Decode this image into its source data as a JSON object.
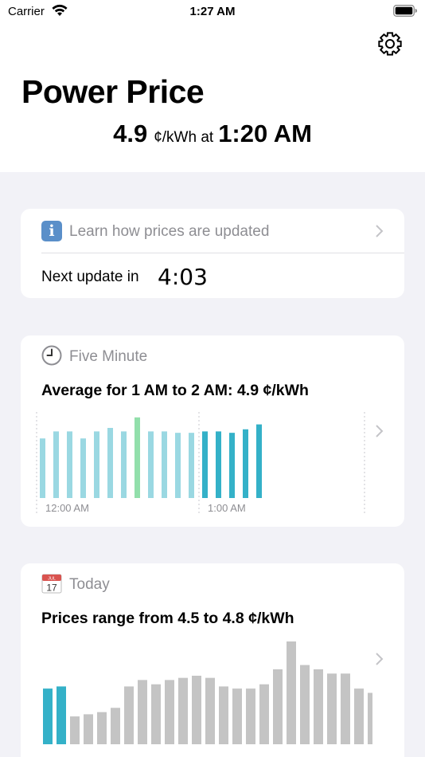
{
  "status_bar": {
    "carrier": "Carrier",
    "time": "1:27 AM"
  },
  "header": {
    "title": "Power Price",
    "current_price": "4.9",
    "unit": "¢/kWh at",
    "current_time": "1:20 AM"
  },
  "update_card": {
    "learn_label": "Learn how prices are updated",
    "next_update_label": "Next update in",
    "next_update_value": "4:03"
  },
  "five_minute_card": {
    "section_label": "Five Minute",
    "headline": "Average for 1 AM to 2 AM: 4.9 ¢/kWh"
  },
  "today_card": {
    "section_label": "Today",
    "calendar_icon_month": "JUL",
    "calendar_icon_day": "17",
    "headline": "Prices range from 4.5 to 4.8 ¢/kWh"
  },
  "colors": {
    "past_bar": "#9ad8e2",
    "current_bar": "#92dfab",
    "hour_bar": "#34b1c8",
    "today_bar": "#c4c4c4",
    "today_highlight": "#34b1c8"
  },
  "chart_data": [
    {
      "type": "bar",
      "name": "five_minute",
      "x_tick_labels": [
        "12:00 AM",
        "1:00 AM"
      ],
      "values": [
        4.7,
        4.8,
        4.8,
        4.7,
        4.8,
        4.85,
        4.8,
        5.0,
        4.8,
        4.8,
        4.78,
        4.78,
        4.8,
        4.8,
        4.78,
        4.83,
        4.9
      ],
      "bar_roles": [
        "past",
        "past",
        "past",
        "past",
        "past",
        "past",
        "past",
        "current",
        "past",
        "past",
        "past",
        "past",
        "hour",
        "hour",
        "hour",
        "hour",
        "hour"
      ],
      "ylim": [
        3.85,
        5.1
      ],
      "grid": false
    },
    {
      "type": "bar",
      "name": "today",
      "values": [
        4.58,
        4.59,
        4.45,
        4.46,
        4.47,
        4.49,
        4.59,
        4.62,
        4.6,
        4.62,
        4.63,
        4.64,
        4.63,
        4.59,
        4.58,
        4.58,
        4.6,
        4.67,
        4.8,
        4.69,
        4.67,
        4.65,
        4.65,
        4.58,
        4.56
      ],
      "highlight_indices": [
        0,
        1
      ],
      "ylim": [
        4.32,
        4.8
      ],
      "grid": false
    }
  ]
}
